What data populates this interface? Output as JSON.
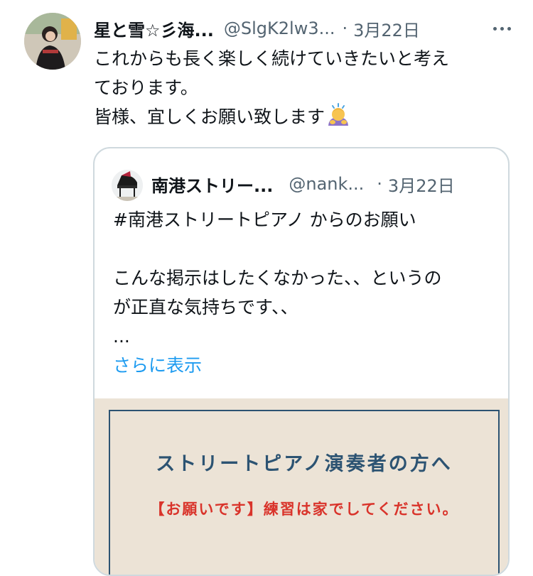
{
  "tweet": {
    "author_name": "星と雪☆彡海...",
    "handle": "@SlgK2lw3...",
    "separator": "·",
    "date": "3月22日",
    "more_icon": "more-horizontal-icon",
    "lines": [
      "これからも長く楽しく続けていきたいと考え",
      "ております。",
      "皆様、宜しくお願い致します"
    ],
    "emoji": "person-bowing-emoji"
  },
  "quote": {
    "author_name": "南港ストリー...",
    "handle": "@nank...",
    "separator": "·",
    "date": "3月22日",
    "lines": [
      "#南港ストリートピアノ からのお願い",
      "",
      "こんな掲示はしたくなかった、、というの",
      "が正直な気持ちです、、",
      "..."
    ],
    "show_more": "さらに表示",
    "media": {
      "title": "ストリートピアノ演奏者の方へ",
      "subtitle": "【お願いです】練習は家でしてください。"
    }
  },
  "colors": {
    "text": "#0f1419",
    "secondary": "#536471",
    "link": "#1d9bf0",
    "border": "#cfd9de",
    "notice_bg": "#ece3d6",
    "notice_blue": "#2c5372",
    "notice_red": "#d9342b"
  }
}
